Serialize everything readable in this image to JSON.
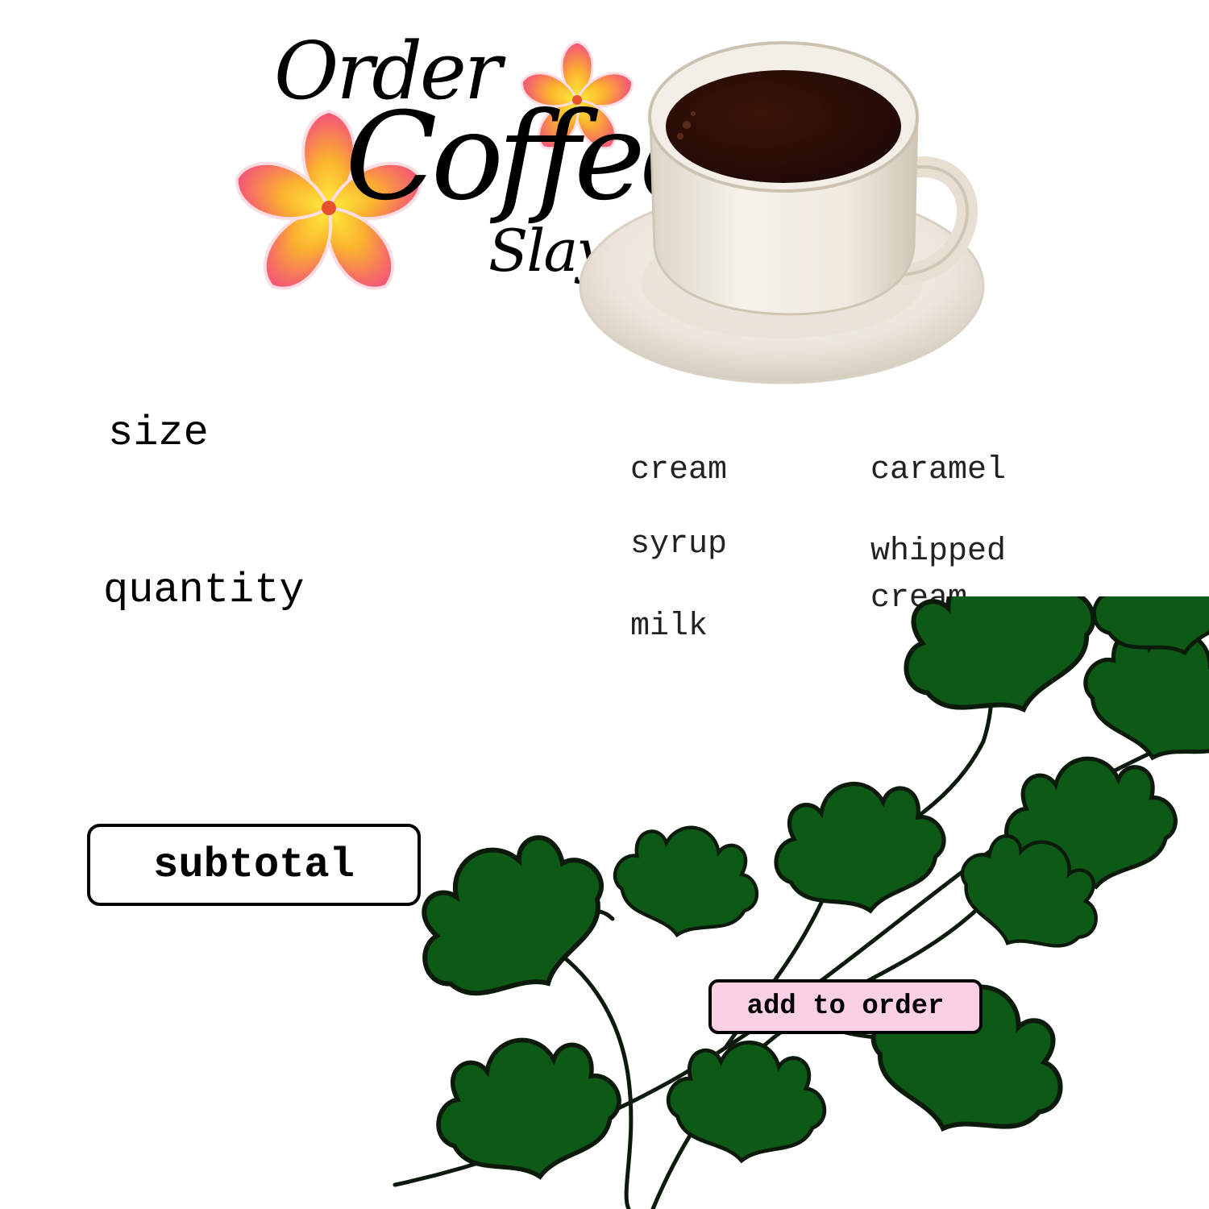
{
  "header": {
    "title_line1": "Order",
    "title_line2": "Coffee",
    "title_line3": "Slay"
  },
  "form": {
    "size_label": "size",
    "quantity_label": "quantity"
  },
  "options": {
    "cream": "cream",
    "caramel": "caramel",
    "syrup": "syrup",
    "whipped_cream_line1": "whipped",
    "whipped_cream_line2": "cream",
    "milk": "milk"
  },
  "actions": {
    "subtotal_label": "subtotal",
    "add_label": "add to order"
  },
  "icons": [
    "flower-icon",
    "coffee-cup-icon",
    "ivy-leaves-decoration"
  ],
  "colors": {
    "flower_petal": "#f45c7a",
    "flower_center": "#fcd12a",
    "leaf": "#0c5a16",
    "coffee": "#2a0e08",
    "add_button": "#fcd0e4"
  }
}
